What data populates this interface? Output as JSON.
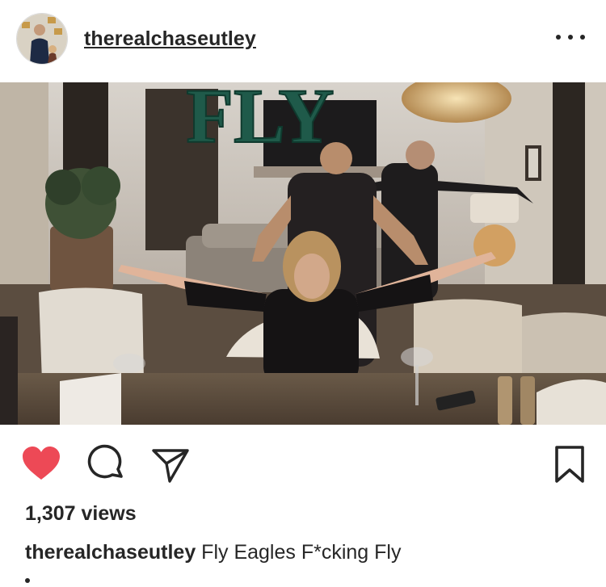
{
  "post": {
    "username": "therealchaseutley",
    "views_label": "1,307 views",
    "caption_user": "therealchaseutley",
    "caption_text": "Fly Eagles F*cking Fly",
    "video_overlay_text": "FLY"
  },
  "icons": {
    "more": "more-horizontal-icon",
    "like": "heart-filled-icon",
    "comment": "comment-bubble-icon",
    "share": "paper-plane-icon",
    "save": "bookmark-icon"
  },
  "colors": {
    "like": "#ed4956",
    "text": "#262626",
    "overlay_text": "#1f5a4a"
  }
}
